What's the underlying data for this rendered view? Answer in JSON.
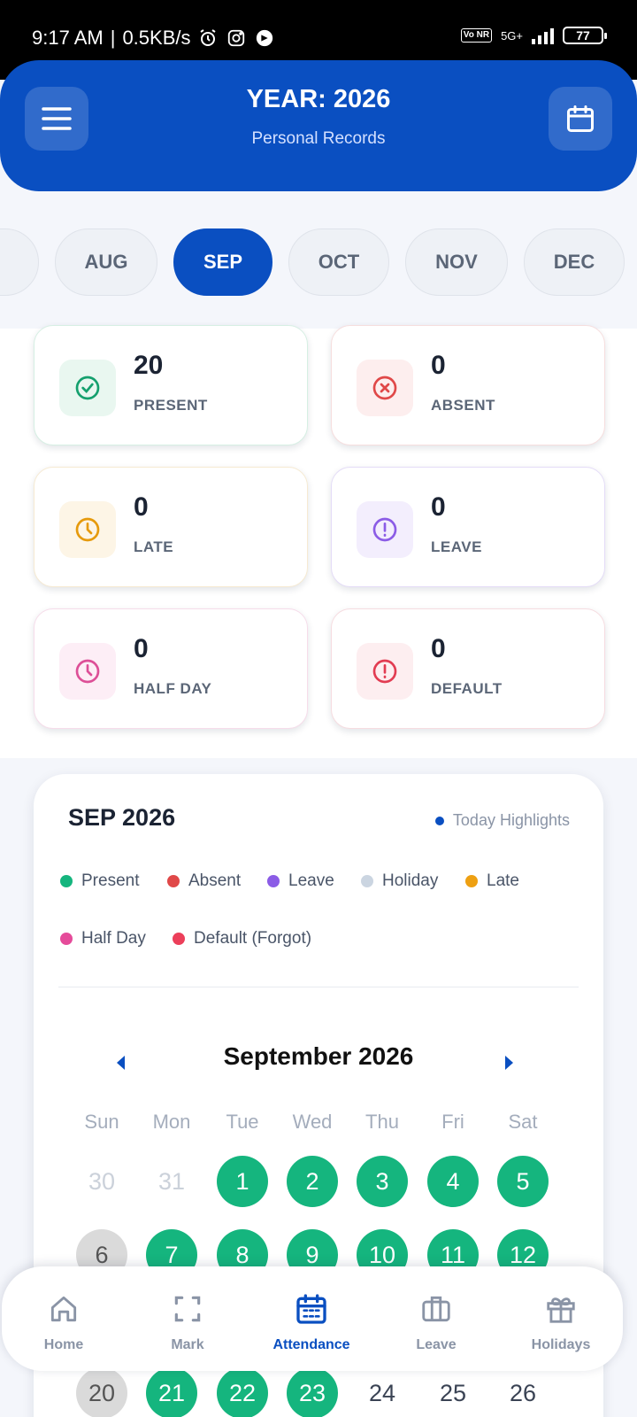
{
  "status_bar": {
    "time": "9:17 AM",
    "speed": "0.5KB/s",
    "network": "5G+",
    "volte": "Vo NR",
    "battery": "77"
  },
  "header": {
    "title": "YEAR: 2026",
    "subtitle": "Personal Records",
    "menu_icon": "hamburger-icon",
    "calendar_icon": "calendar-icon"
  },
  "months": {
    "items": [
      "AUG",
      "SEP",
      "OCT",
      "NOV",
      "DEC"
    ],
    "selected": "SEP"
  },
  "stats": [
    {
      "value": "20",
      "label": "PRESENT",
      "icon": "check-circle-icon",
      "color": "#15a06e",
      "bg": "#e9f7f0"
    },
    {
      "value": "0",
      "label": "ABSENT",
      "icon": "x-circle-icon",
      "color": "#e04848",
      "bg": "#fdeeee"
    },
    {
      "value": "0",
      "label": "LATE",
      "icon": "clock-icon",
      "color": "#e69a0c",
      "bg": "#fdf5e6"
    },
    {
      "value": "0",
      "label": "LEAVE",
      "icon": "alert-circle-icon",
      "color": "#8b5ce6",
      "bg": "#f3eefd"
    },
    {
      "value": "0",
      "label": "HALF DAY",
      "icon": "clock-icon",
      "color": "#dd4f97",
      "bg": "#fdeef6"
    },
    {
      "value": "0",
      "label": "DEFAULT",
      "icon": "alert-circle-icon",
      "color": "#e23c52",
      "bg": "#fdeef0"
    }
  ],
  "calendar": {
    "heading": "SEP 2026",
    "today_highlights": "Today Highlights",
    "legend": [
      {
        "label": "Present",
        "color": "#15b57e"
      },
      {
        "label": "Absent",
        "color": "#e04848"
      },
      {
        "label": "Leave",
        "color": "#8b5ce6"
      },
      {
        "label": "Holiday",
        "color": "#cbd5e1"
      },
      {
        "label": "Late",
        "color": "#eea012"
      },
      {
        "label": "Half Day",
        "color": "#e54b9a"
      },
      {
        "label": "Default (Forgot)",
        "color": "#ec3f5a"
      }
    ],
    "month_title": "September 2026",
    "weekdays": [
      "Sun",
      "Mon",
      "Tue",
      "Wed",
      "Thu",
      "Fri",
      "Sat"
    ],
    "weeks": [
      [
        {
          "d": "30",
          "s": "o"
        },
        {
          "d": "31",
          "s": "o"
        },
        {
          "d": "1",
          "s": "p"
        },
        {
          "d": "2",
          "s": "p"
        },
        {
          "d": "3",
          "s": "p"
        },
        {
          "d": "4",
          "s": "p"
        },
        {
          "d": "5",
          "s": "p"
        }
      ],
      [
        {
          "d": "6",
          "s": "t"
        },
        {
          "d": "7",
          "s": "p"
        },
        {
          "d": "8",
          "s": "p"
        },
        {
          "d": "9",
          "s": "p"
        },
        {
          "d": "10",
          "s": "p"
        },
        {
          "d": "11",
          "s": "p"
        },
        {
          "d": "12",
          "s": "p"
        }
      ],
      [
        {
          "d": "20",
          "s": "t"
        },
        {
          "d": "21",
          "s": "p"
        },
        {
          "d": "22",
          "s": "p"
        },
        {
          "d": "23",
          "s": "p"
        },
        {
          "d": "24",
          "s": "n"
        },
        {
          "d": "25",
          "s": "n"
        },
        {
          "d": "26",
          "s": "n"
        }
      ]
    ]
  },
  "bottom_nav": {
    "items": [
      {
        "label": "Home",
        "icon": "home-icon"
      },
      {
        "label": "Mark",
        "icon": "scan-icon"
      },
      {
        "label": "Attendance",
        "icon": "calendar-icon"
      },
      {
        "label": "Leave",
        "icon": "briefcase-icon"
      },
      {
        "label": "Holidays",
        "icon": "gift-icon"
      }
    ],
    "active": "Attendance"
  }
}
